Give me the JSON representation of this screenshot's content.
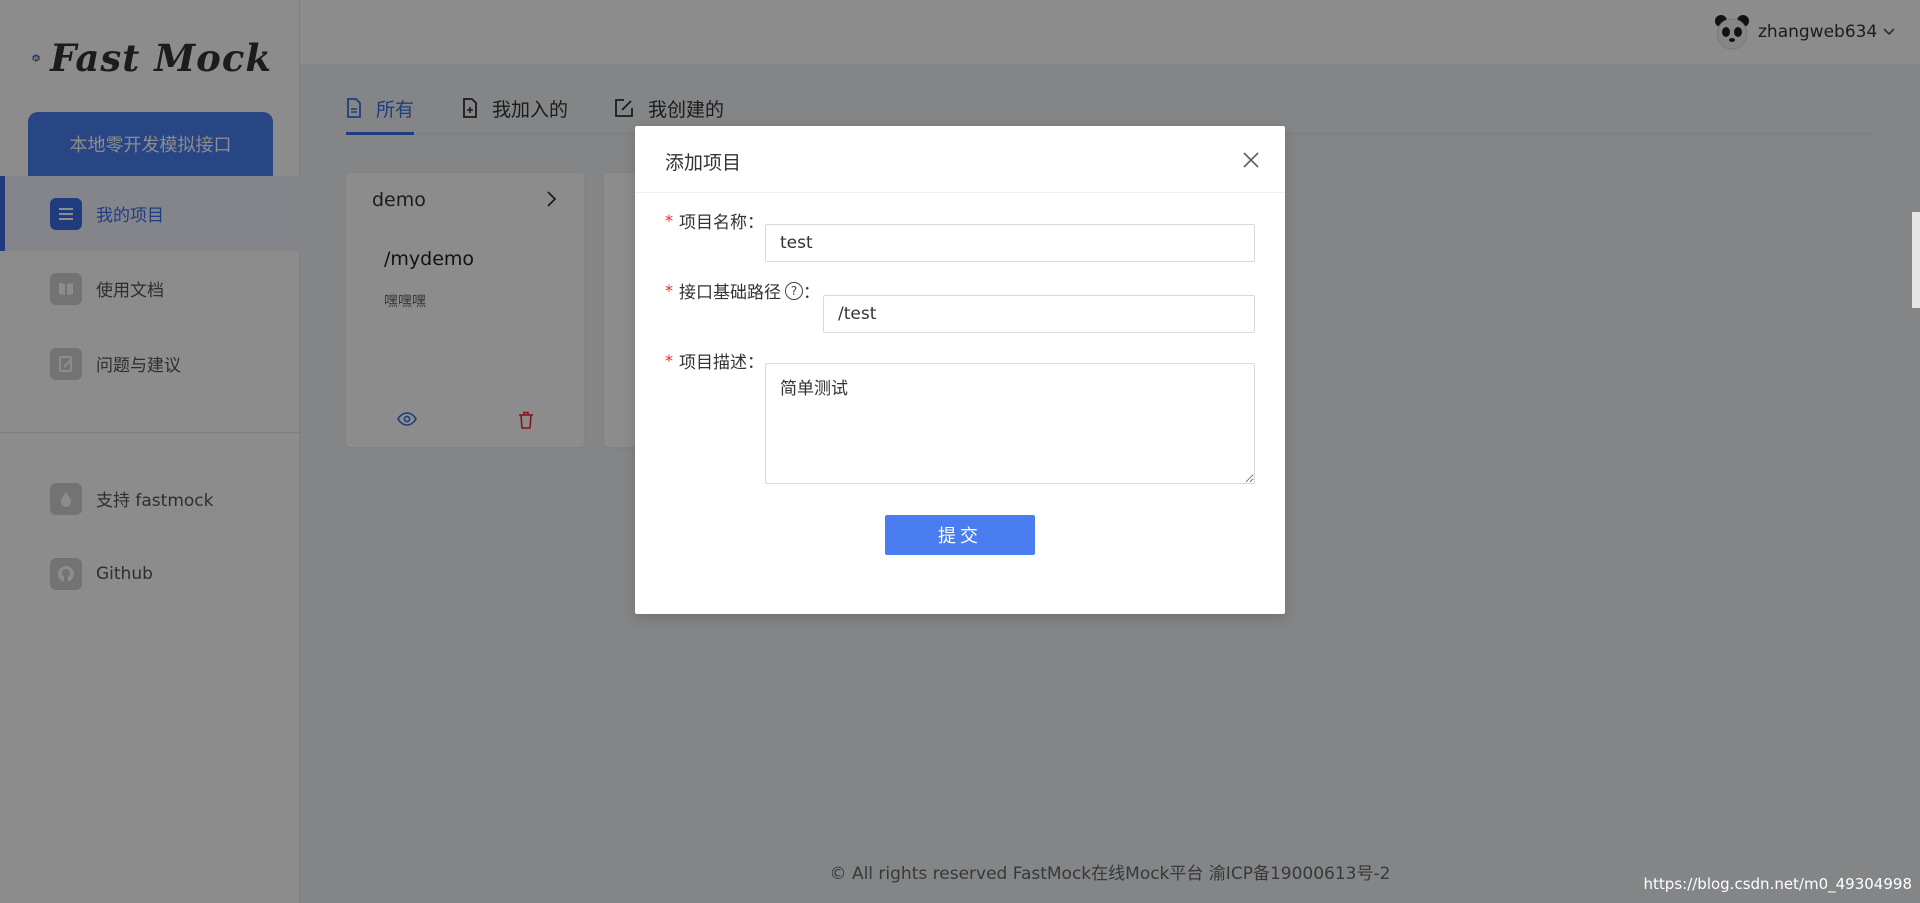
{
  "brand": {
    "name": "Fast Mock"
  },
  "sidebar": {
    "promo_label": "本地零开发模拟接口",
    "items": [
      {
        "label": "我的项目",
        "icon": "list-icon"
      },
      {
        "label": "使用文档",
        "icon": "book-icon"
      },
      {
        "label": "问题与建议",
        "icon": "feedback-icon"
      }
    ],
    "links": [
      {
        "label": "支持 fastmock",
        "icon": "drop-icon"
      },
      {
        "label": "Github",
        "icon": "github-icon"
      }
    ]
  },
  "header": {
    "username": "zhangweb634"
  },
  "tabs": [
    {
      "label": "所有",
      "active": true
    },
    {
      "label": "我加入的",
      "active": false
    },
    {
      "label": "我创建的",
      "active": false
    }
  ],
  "projects": [
    {
      "name": "demo",
      "path": "/mydemo",
      "description": "嘿嘿嘿"
    }
  ],
  "footer": {
    "text": "© All rights reserved FastMock在线Mock平台 渝ICP备19000613号-2"
  },
  "watermark": "https://blog.csdn.net/m0_49304998",
  "modal": {
    "title": "添加项目",
    "fields": {
      "name": {
        "label": "项目名称",
        "value": "test"
      },
      "base_path": {
        "label": "接口基础路径",
        "value": "/test"
      },
      "description": {
        "label": "项目描述",
        "value": "简单测试"
      }
    },
    "submit_label": "提交"
  },
  "colors": {
    "primary": "#3b6ee8",
    "button": "#4a7ef0",
    "required": "#f5222d",
    "danger": "#f5222d"
  }
}
